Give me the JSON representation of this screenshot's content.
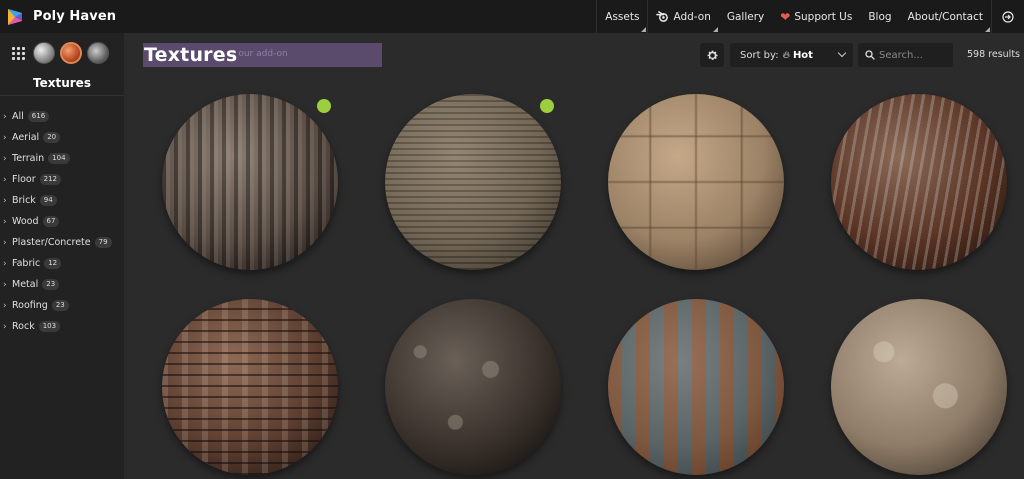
{
  "brand": {
    "name": "Poly Haven"
  },
  "nav": {
    "items": [
      {
        "label": "Assets"
      },
      {
        "label": "Add-on"
      },
      {
        "label": "Gallery"
      },
      {
        "label": "Support Us"
      },
      {
        "label": "Blog"
      },
      {
        "label": "About/Contact"
      }
    ]
  },
  "sidebar": {
    "title": "Textures",
    "categories": [
      {
        "label": "All",
        "count": "616"
      },
      {
        "label": "Aerial",
        "count": "20"
      },
      {
        "label": "Terrain",
        "count": "104"
      },
      {
        "label": "Floor",
        "count": "212"
      },
      {
        "label": "Brick",
        "count": "94"
      },
      {
        "label": "Wood",
        "count": "67"
      },
      {
        "label": "Plaster/Concrete",
        "count": "79"
      },
      {
        "label": "Fabric",
        "count": "12"
      },
      {
        "label": "Metal",
        "count": "23"
      },
      {
        "label": "Roofing",
        "count": "23"
      },
      {
        "label": "Rock",
        "count": "103"
      }
    ]
  },
  "main": {
    "title": "Textures",
    "addon_hint": "t our add-on",
    "sort_label": "Sort by:",
    "sort_value": "Hot",
    "search_placeholder": "Search...",
    "results": "598 results"
  },
  "colors": {
    "new_badge": "#9bcf3f",
    "heart": "#e65c4f",
    "header_band": "#5a4a6c"
  }
}
